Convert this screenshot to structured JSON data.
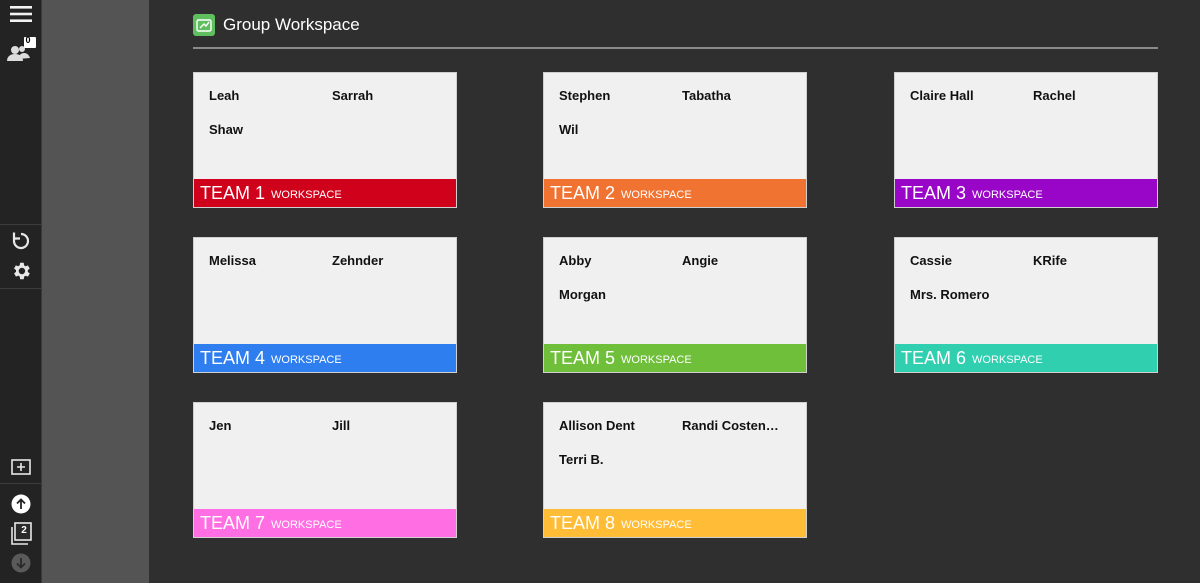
{
  "toolbar": {
    "participants_count": "0",
    "page_count": "2"
  },
  "header": {
    "title": "Group Workspace"
  },
  "workspace_label": "WORKSPACE",
  "teams": [
    {
      "label": "TEAM 1",
      "color": "#d0021b",
      "members": [
        "Leah",
        "Sarrah",
        "Shaw"
      ]
    },
    {
      "label": "TEAM 2",
      "color": "#f07332",
      "members": [
        "Stephen",
        "Tabatha",
        "Wil"
      ]
    },
    {
      "label": "TEAM 3",
      "color": "#9a06c8",
      "members": [
        "Claire Hall",
        "Rachel"
      ]
    },
    {
      "label": "TEAM 4",
      "color": "#2e7ef0",
      "members": [
        "Melissa",
        "Zehnder"
      ]
    },
    {
      "label": "TEAM 5",
      "color": "#6fbf3b",
      "members": [
        "Abby",
        "Angie",
        "Morgan"
      ]
    },
    {
      "label": "TEAM 6",
      "color": "#2fcfb0",
      "members": [
        "Cassie",
        "KRife",
        "Mrs. Romero"
      ]
    },
    {
      "label": "TEAM 7",
      "color": "#ff6fe3",
      "members": [
        "Jen",
        "Jill"
      ]
    },
    {
      "label": "TEAM 8",
      "color": "#ffbc36",
      "members": [
        "Allison Dent",
        "Randi Costen…",
        "Terri B."
      ]
    }
  ]
}
